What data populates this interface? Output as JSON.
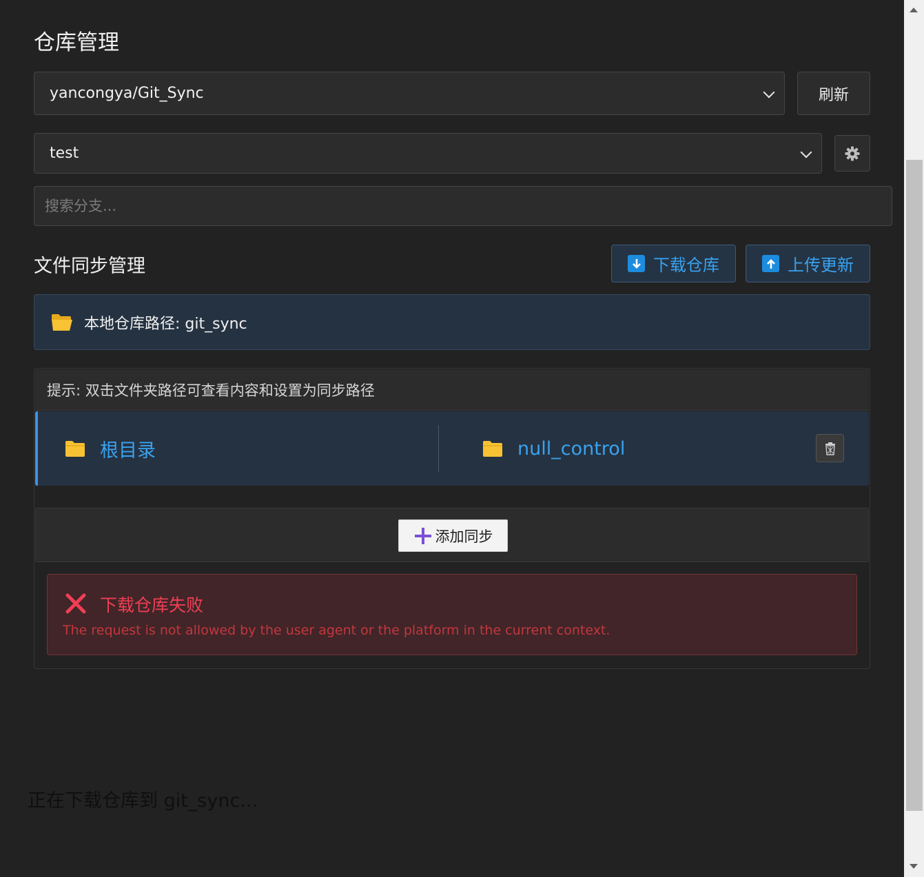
{
  "header": {
    "title": "仓库管理"
  },
  "repo": {
    "selected": "yancongya/Git_Sync",
    "refresh_label": "刷新"
  },
  "branch": {
    "selected": "test",
    "search_placeholder": "搜索分支..."
  },
  "sync_section": {
    "title": "文件同步管理",
    "download_label": "下载仓库",
    "upload_label": "上传更新",
    "local_path_label": "本地仓库路径: git_sync",
    "hint": "提示: 双击文件夹路径可查看内容和设置为同步路径",
    "rows": [
      {
        "source": "根目录",
        "target": "null_control"
      }
    ],
    "add_label": "添加同步"
  },
  "error": {
    "title": "下载仓库失败",
    "message": "The request is not allowed by the user agent or the platform in the current context."
  },
  "status": {
    "text": "正在下载仓库到 git_sync..."
  },
  "colors": {
    "background": "#222222",
    "accent": "#39a2f0",
    "folder": "#f7c233",
    "error": "#ef3f54",
    "add_plus": "#7b4fd6"
  }
}
